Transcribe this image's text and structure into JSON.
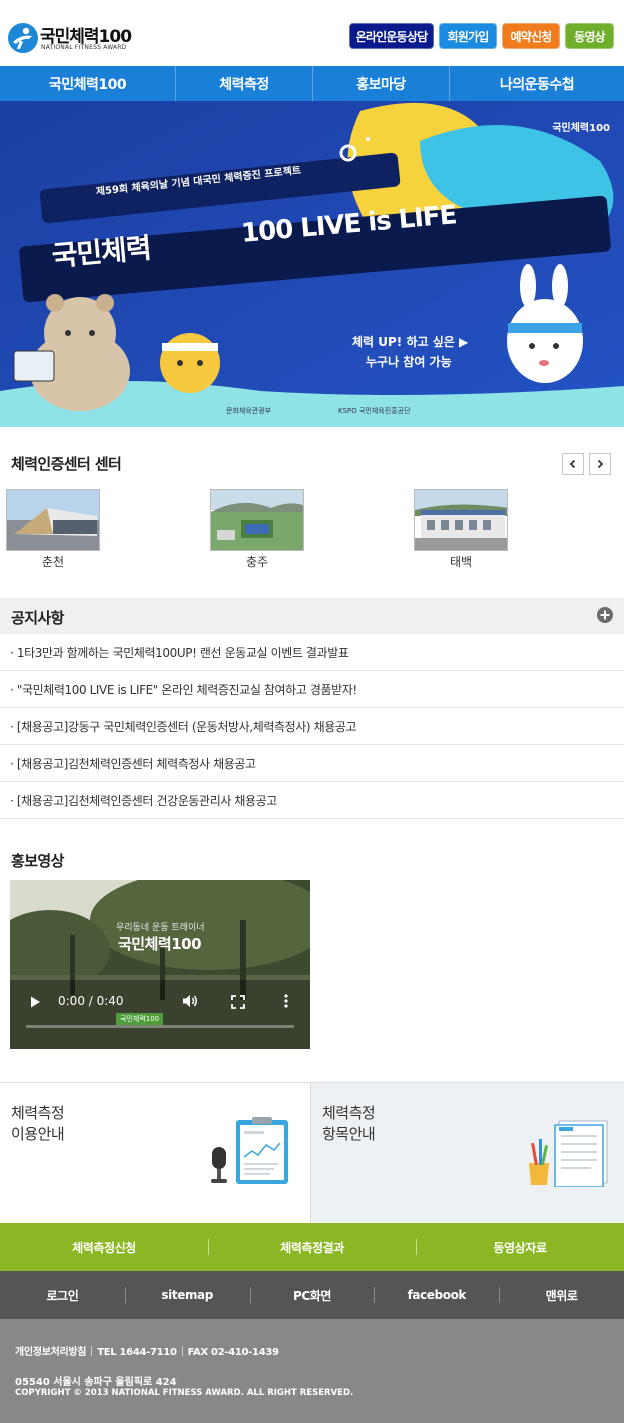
{
  "header": {
    "logo_title": "국민체력100",
    "logo_sub": "NATIONAL FITNESS AWARD",
    "buttons": [
      {
        "label": "온라인운동상담",
        "color": "#0a1a8c"
      },
      {
        "label": "회원가입",
        "color": "#1a8be0"
      },
      {
        "label": "예약신청",
        "color": "#f07c1e"
      },
      {
        "label": "동영상",
        "color": "#6fae2a"
      }
    ]
  },
  "nav": {
    "items": [
      {
        "label": "국민체력100"
      },
      {
        "label": "체력측정"
      },
      {
        "label": "홍보마당"
      },
      {
        "label": "나의운동수첩"
      }
    ]
  },
  "banner": {
    "brand": "국민체력100",
    "event_line": "제59회 체육의날 기념 대국민 체력증진 프로젝트",
    "headline_kr": "국민체력",
    "headline_en": "100 LIVE is LIFE",
    "cta_line1": "체력 UP! 하고 싶은 ▶",
    "cta_line2": "누구나 참여 가능",
    "sponsor1": "문화체육관광부",
    "sponsor2": "KSPO 국민체육진흥공단"
  },
  "centers": {
    "title": "체력인증센터 센터",
    "items": [
      {
        "label": "춘천"
      },
      {
        "label": "충주"
      },
      {
        "label": "태백"
      }
    ]
  },
  "notice": {
    "title": "공지사항",
    "items": [
      "· 1타3만과 함께하는 국민체력100UP! 랜선 운동교실 이벤트 결과발표",
      "· \"국민체력100 LIVE is LIFE\" 온라인 체력증진교실 참여하고 경품받자!",
      "· [채용공고]강동구 국민체력인증센터 (운동처방사,체력측정사) 채용공고",
      "· [채용공고]김천체력인증센터 체력측정사 채용공고",
      "· [채용공고]김천체력인증센터 건강운동관리사 채용공고"
    ]
  },
  "video": {
    "title": "홍보영상",
    "overlay_small": "우리동네 운동 트레이너",
    "overlay_big": "국민체력100",
    "time": "0:00 / 0:40",
    "badge": "국민체력100"
  },
  "info": {
    "left": {
      "line1": "체력측정",
      "line2": "이용안내"
    },
    "right": {
      "line1": "체력측정",
      "line2": "항목안내"
    }
  },
  "quick_links": [
    "체력측정신청",
    "체력측정결과",
    "동영상자료"
  ],
  "util_links": [
    "로그인",
    "sitemap",
    "PC화면",
    "facebook",
    "맨위로"
  ],
  "footer": {
    "privacy": "개인정보처리방침",
    "tel": "TEL 1644-7110",
    "fax": "FAX 02-410-1439",
    "address": "05540 서울시 송파구 올림픽로 424",
    "copyright": "COPYRIGHT © 2013 NATIONAL FITNESS AWARD. ALL RIGHT RESERVED."
  }
}
